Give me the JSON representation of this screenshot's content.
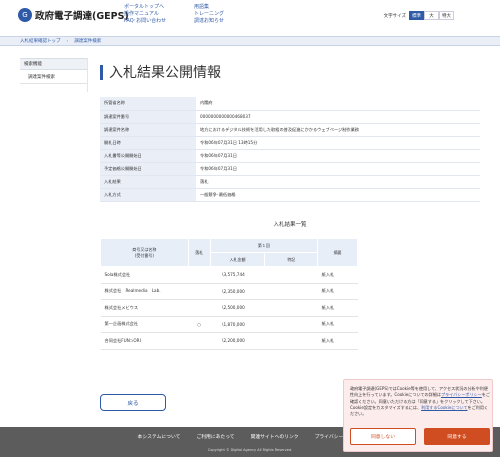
{
  "header": {
    "logo_mark": "G",
    "logo_text": "政府電子調達(GEPS)",
    "links_col1": [
      "ポータルトップへ",
      "操作マニュアル",
      "FAQ･お問い合わせ"
    ],
    "links_col2": [
      "用語集",
      "トレーニング",
      "調達お知らせ"
    ],
    "fontsize_label": "文字サイズ",
    "fontsize_options": [
      "標準",
      "大",
      "特大"
    ],
    "fontsize_selected": "標準"
  },
  "breadcrumb": [
    "入札結果確認トップ",
    "調達案件検索"
  ],
  "sidebar": {
    "heading": "検索機能",
    "items": [
      "調達案件検索"
    ]
  },
  "page_title": "入札結果公開情報",
  "info_rows": [
    {
      "key": "所管省名称",
      "value": "内閣府"
    },
    {
      "key": "調達案件番号",
      "value": "0000000000000468037"
    },
    {
      "key": "調達案件名称",
      "value": "地方におけるデジタル技術を活用した取組の普及促進にかかるウェブページ制作業務"
    },
    {
      "key": "開札日時",
      "value": "令和06年07月31日 13時15分"
    },
    {
      "key": "入札書等公開開始日",
      "value": "令和06年07月31日"
    },
    {
      "key": "予定価格公開開始日",
      "value": "令和06年07月31日"
    },
    {
      "key": "入札結果",
      "value": "落札"
    },
    {
      "key": "入札方式",
      "value": "一般競争･最低価格"
    }
  ],
  "result_title": "入札結果一覧",
  "result_table": {
    "h_company": "商号又は名称\n(受付番号)",
    "h_winner": "落札",
    "h_round": "第１回",
    "h_amount": "入札金額",
    "h_note": "特記",
    "h_remarks": "摘要",
    "rows": [
      {
        "company": "Sola株式会社",
        "winner": "",
        "amount": "\\3,575,744",
        "note": "",
        "remarks": "紙入札"
      },
      {
        "company": "株式会社　Realmedia　Lab.",
        "winner": "",
        "amount": "\\2,350,000",
        "note": "",
        "remarks": "紙入札"
      },
      {
        "company": "株式会社メビウス",
        "winner": "",
        "amount": "\\2,500,000",
        "note": "",
        "remarks": "紙入札"
      },
      {
        "company": "第一企画株式会社",
        "winner": "○",
        "amount": "\\1,870,000",
        "note": "",
        "remarks": "紙入札"
      },
      {
        "company": "合同会社FUN⊃ORI",
        "winner": "",
        "amount": "\\2,200,000",
        "note": "",
        "remarks": "紙入札"
      }
    ]
  },
  "back_button": "戻る",
  "footer": {
    "links": [
      "本システムについて",
      "ご利用にあたって",
      "関連サイトへのリンク",
      "プライバシーポリシー"
    ],
    "copyright": "Copyright © Digital Agency All Rights Reserved."
  },
  "cookie_banner": {
    "text_1": "政府電子調達(GEPS)ではCookie等を使用して、アクセス状況の分析や利便性向上を行っています。Cookieについての詳細は",
    "link_1": "プライバシーポリシー",
    "text_2": "をご確認ください。同意いただける方は「同意する」をクリックして下さい。Cookie設定をカスタマイズするには、",
    "link_2": "利用するCookieについて",
    "text_3": "をご利用ください。",
    "decline": "同意しない",
    "accept": "同意する"
  }
}
